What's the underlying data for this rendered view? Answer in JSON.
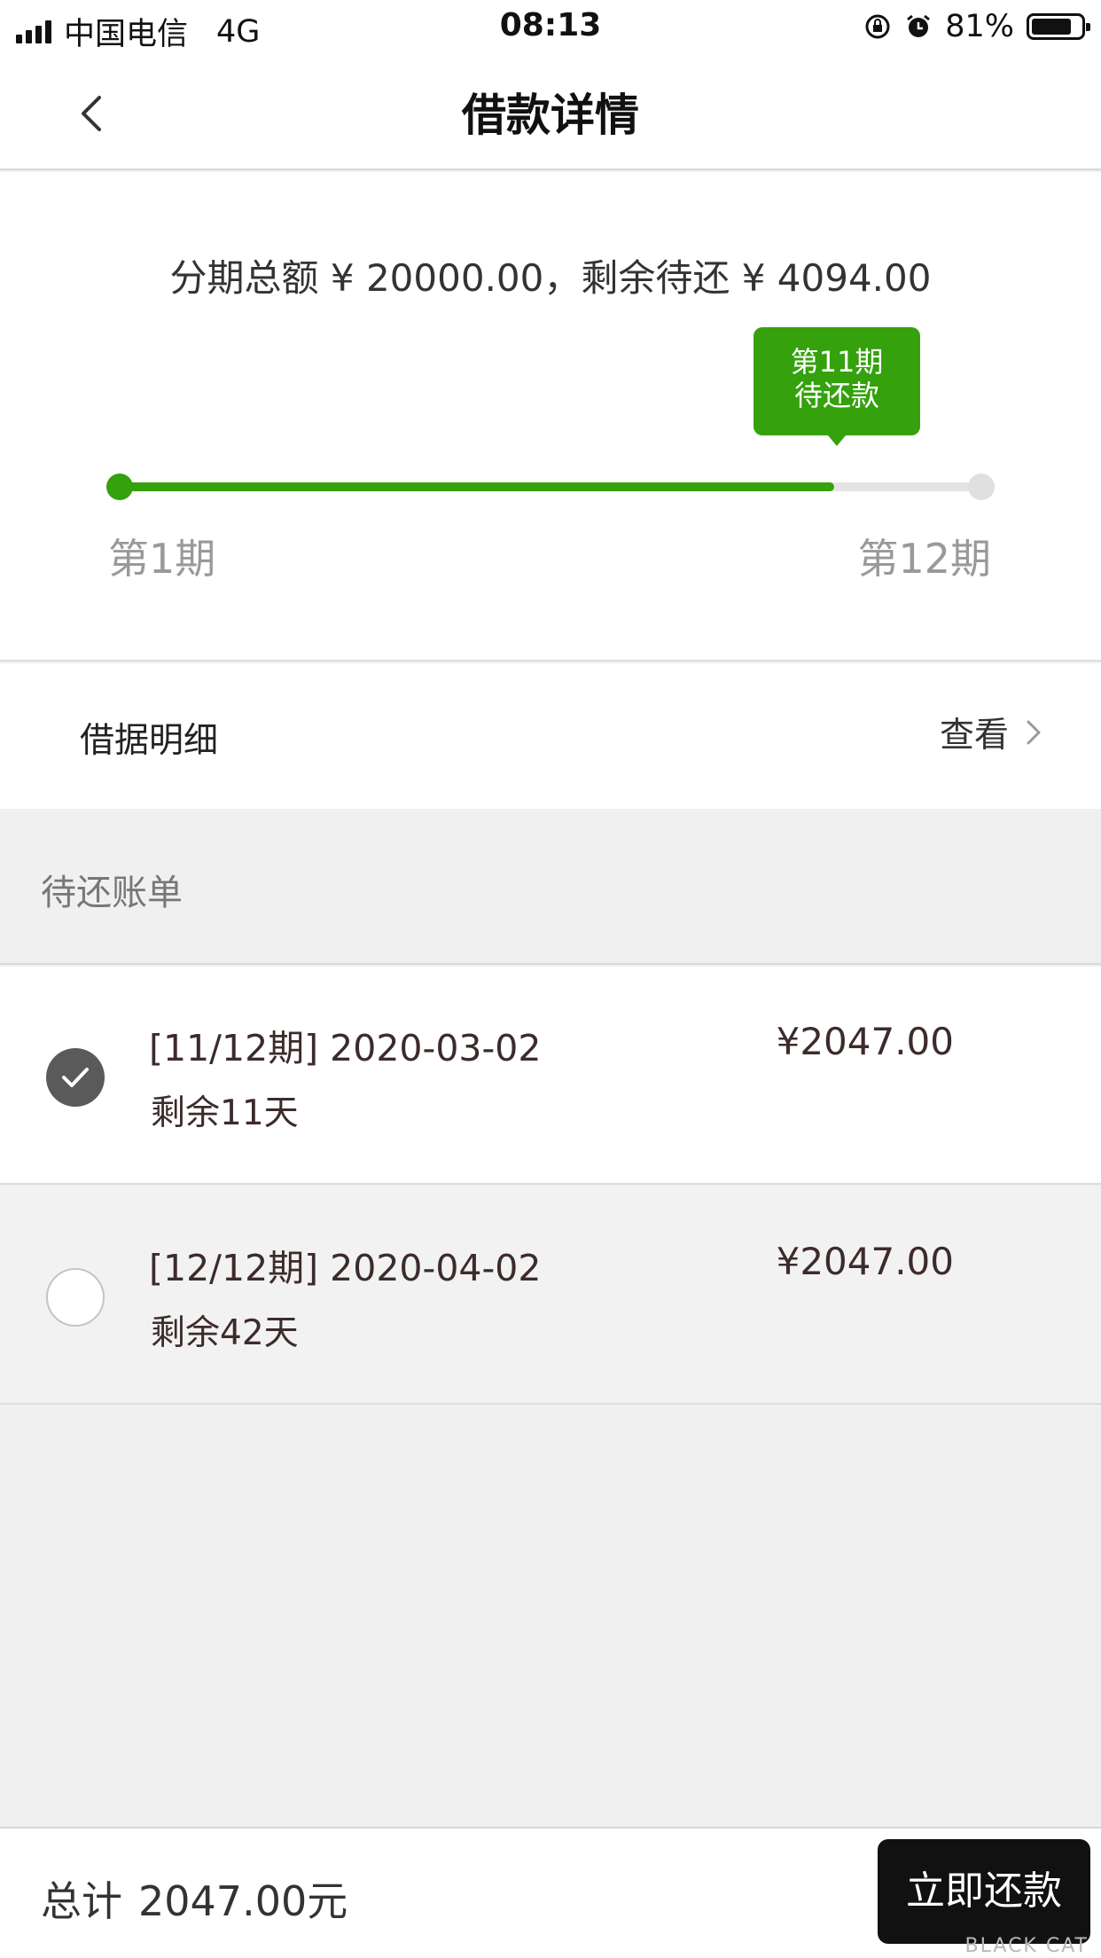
{
  "status_bar": {
    "carrier": "中国电信",
    "network": "4G",
    "time": "08:13",
    "battery": "81%",
    "battery_level": 0.81
  },
  "nav": {
    "title": "借款详情"
  },
  "summary": {
    "text": "分期总额 ¥ 20000.00，剩余待还 ¥ 4094.00",
    "tooltip_line1": "第11期",
    "tooltip_line2": "待还款",
    "start_label": "第1期",
    "end_label": "第12期",
    "progress": 0.83
  },
  "detail": {
    "label": "借据明细",
    "view": "查看"
  },
  "section": {
    "title": "待还账单"
  },
  "bills": [
    {
      "title": "[11/12期] 2020-03-02",
      "remain": "剩余11天",
      "amount": "¥2047.00",
      "checked": true
    },
    {
      "title": "[12/12期] 2020-04-02",
      "remain": "剩余42天",
      "amount": "¥2047.00",
      "checked": false
    }
  ],
  "bottom": {
    "total_label": "总计",
    "total_value": "2047.00元",
    "pay_button": "立即还款",
    "watermark": "BLACK CAT"
  },
  "colors": {
    "accent_green": "#34a10d",
    "button_dark": "#111111"
  }
}
